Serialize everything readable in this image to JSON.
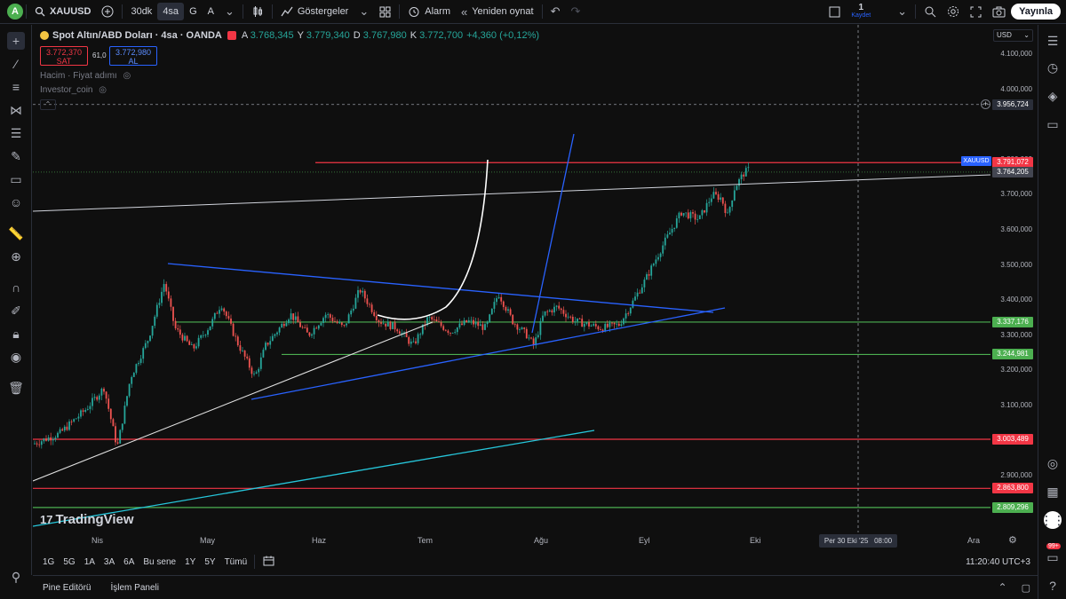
{
  "topbar": {
    "avatar_letter": "A",
    "symbol": "XAUUSD",
    "interval_1": "30dk",
    "interval_2": "4sa",
    "interval_3": "G",
    "interval_4": "A",
    "indicators": "Göstergeler",
    "alarm": "Alarm",
    "replay": "Yeniden oynat",
    "layout_count": "1",
    "save": "Kaydet",
    "publish": "Yayınla"
  },
  "legend": {
    "title": "Spot Altın/ABD Doları · 4sa · OANDA",
    "open_label": "A",
    "open": "3.768,345",
    "high_label": "Y",
    "high": "3.779,340",
    "low_label": "D",
    "low": "3.767,980",
    "close_label": "K",
    "close": "3.772,700",
    "change": "+4,360 (+0,12%)",
    "sell_price": "3.772,370",
    "sell_label": "SAT",
    "spread": "61,0",
    "buy_price": "3.772,980",
    "buy_label": "AL",
    "volume_label": "Hacim · Fiyat adımı",
    "indicator_label": "Investor_coin"
  },
  "price_axis": {
    "currency": "USD",
    "ticks": [
      "4.100,000",
      "4.000,000",
      "3.800,000",
      "3.700,000",
      "3.600,000",
      "3.500,000",
      "3.400,000",
      "3.300,000",
      "3.200,000",
      "3.100,000",
      "2.900,000"
    ],
    "badges": [
      {
        "value": "3.956,724",
        "color": "#2a2e39"
      },
      {
        "value": "3.791,072",
        "color": "#f23645"
      },
      {
        "value": "3.764,205",
        "color": "#434651"
      },
      {
        "value": "3.337,176",
        "color": "#4caf50"
      },
      {
        "value": "3.244,981",
        "color": "#4caf50"
      },
      {
        "value": "3.003,489",
        "color": "#f23645"
      },
      {
        "value": "2.863,800",
        "color": "#f23645"
      },
      {
        "value": "2.809,296",
        "color": "#4caf50"
      }
    ],
    "symbol_tag": "XAUUSD"
  },
  "time_axis": {
    "labels": [
      "Nis",
      "May",
      "Haz",
      "Tem",
      "Ağu",
      "Eyl",
      "Eki",
      "Ara"
    ],
    "crosshair_date": "Per 30 Eki '25",
    "crosshair_time": "08:00"
  },
  "range_bar": {
    "ranges": [
      "1G",
      "5G",
      "1A",
      "3A",
      "6A",
      "Bu sene",
      "1Y",
      "5Y",
      "Tümü"
    ],
    "clock": "11:20:40 UTC+3"
  },
  "bottom_panel": {
    "tabs": [
      "Pine Editörü",
      "İşlem Paneli"
    ]
  },
  "notifications": "99+",
  "watermark": "TradingView"
}
